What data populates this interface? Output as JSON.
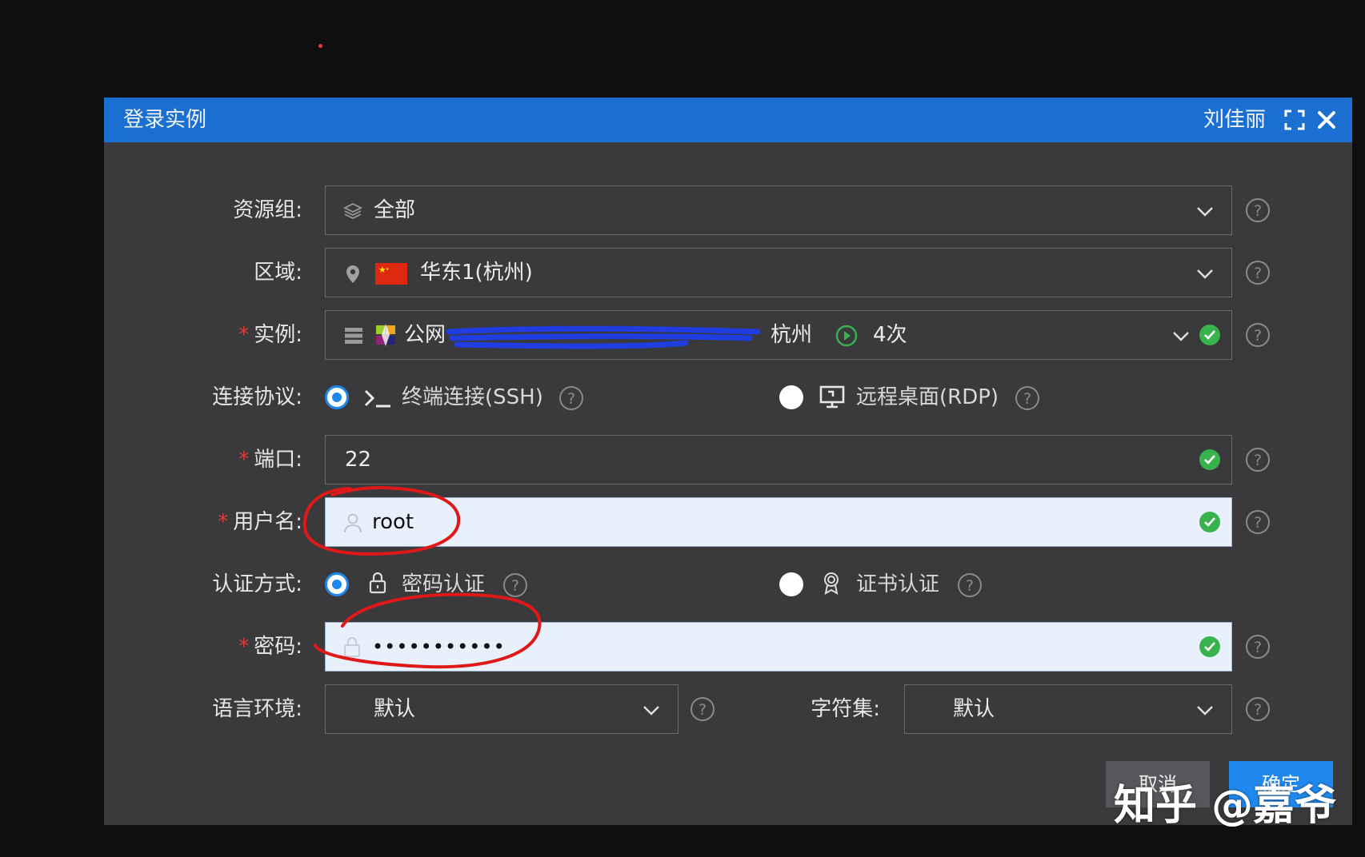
{
  "dialog": {
    "title": "登录实例",
    "user": "刘佳丽"
  },
  "form": {
    "resource_group": {
      "label": "资源组:",
      "value": "全部"
    },
    "region": {
      "label": "区域:",
      "value": "华东1(杭州)"
    },
    "instance": {
      "label": "实例:",
      "network": "公网",
      "city": "杭州",
      "count": "4次"
    },
    "protocol": {
      "label": "连接协议:",
      "ssh": "终端连接(SSH)",
      "rdp": "远程桌面(RDP)"
    },
    "port": {
      "label": "端口:",
      "value": "22"
    },
    "username": {
      "label": "用户名:",
      "value": "root"
    },
    "auth": {
      "label": "认证方式:",
      "password": "密码认证",
      "cert": "证书认证"
    },
    "password": {
      "label": "密码:",
      "value": "•••••••••••"
    },
    "locale": {
      "label": "语言环境:",
      "value": "默认"
    },
    "charset": {
      "label": "字符集:",
      "value": "默认"
    }
  },
  "actions": {
    "cancel": "取消",
    "confirm": "确定"
  },
  "watermark": "知乎 @嘉爷",
  "colors": {
    "titlebar": "#1a6fd0",
    "primary": "#1f88ee",
    "success": "#37b24d",
    "required": "#e23a3a",
    "annotation": "#e01818"
  }
}
